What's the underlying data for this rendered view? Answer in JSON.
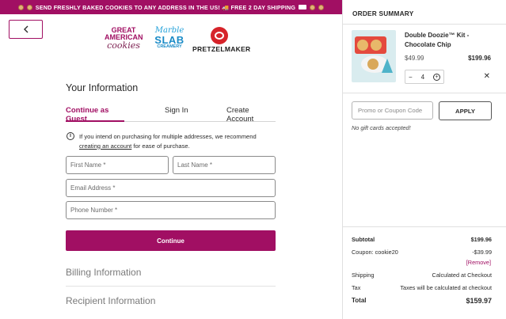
{
  "banner": {
    "text": "SEND FRESHLY BAKED COOKIES TO ANY ADDRESS IN THE US! 🚚 FREE 2 DAY SHIPPING"
  },
  "brands": {
    "gac": {
      "line1": "GREAT",
      "line2": "AMERICAN",
      "line3": "cookies"
    },
    "marble": {
      "line1": "Marble",
      "line2": "SLAB",
      "line3": "CREAMERY"
    },
    "pretzel": {
      "name": "PRETZELMAKER"
    }
  },
  "form": {
    "title": "Your Information",
    "tabs": [
      {
        "label": "Continue as Guest",
        "active": true
      },
      {
        "label": "Sign In",
        "active": false
      },
      {
        "label": "Create Account",
        "active": false
      }
    ],
    "notice_pre": "If you intend on purchasing for multiple addresses, we recommend ",
    "notice_link": "creating an account",
    "notice_post": " for ease of purchase.",
    "first_name_placeholder": "First Name *",
    "last_name_placeholder": "Last Name *",
    "email_placeholder": "Email Address *",
    "phone_placeholder": "Phone Number *",
    "continue_label": "Continue",
    "billing_label": "Billing Information",
    "recipient_label": "Recipient Information"
  },
  "summary": {
    "title": "ORDER SUMMARY",
    "item": {
      "name": "Double Doozie™ Kit - Chocolate Chip",
      "price": "$49.99",
      "total": "$199.96",
      "quantity": "4",
      "minus": "−",
      "plus": "+",
      "remove": "✕"
    },
    "promo_placeholder": "Promo or Coupon Code",
    "apply_label": "APPLY",
    "no_gift": "No gift cards accepted!",
    "subtotal_label": "Subtotal",
    "subtotal_value": "$199.96",
    "coupon_label": "Coupon: cookie20",
    "coupon_value": "-$39.99",
    "coupon_remove": "[Remove]",
    "shipping_label": "Shipping",
    "shipping_value": "Calculated at Checkout",
    "tax_label": "Tax",
    "tax_value": "Taxes will be calculated at checkout",
    "total_label": "Total",
    "total_value": "$159.97"
  },
  "colors": {
    "brand": "#a10f63",
    "accent_blue": "#1f9fd8",
    "pretzel_red": "#d6232a"
  }
}
